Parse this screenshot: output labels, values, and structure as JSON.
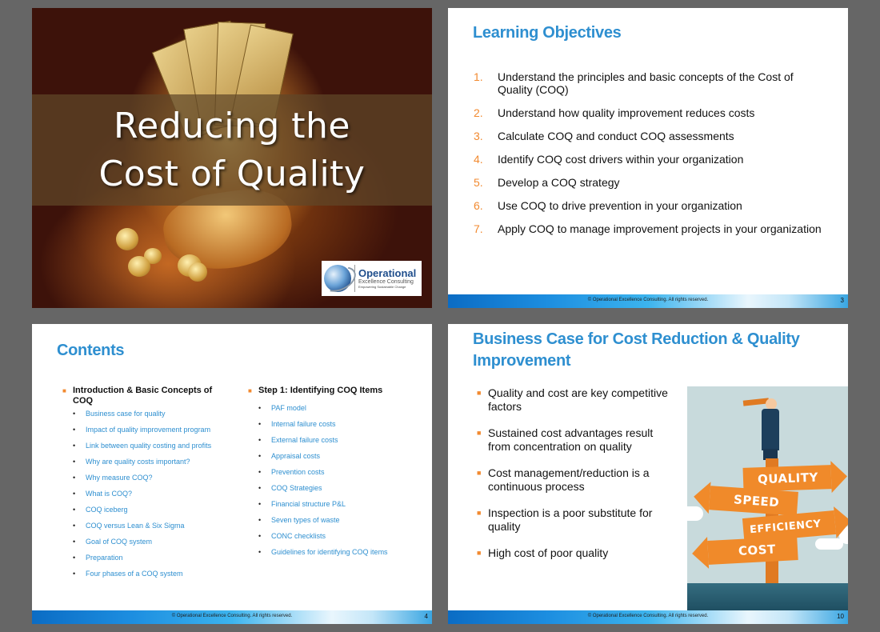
{
  "slides": [
    {
      "id": "cover",
      "title_lines": [
        "Reducing the",
        "Cost of Quality"
      ],
      "logo": {
        "name": "Operational",
        "subtitle": "Excellence Consulting",
        "tagline": "Empowering Sustainable Change"
      }
    },
    {
      "id": "learning-objectives",
      "title": "Learning Objectives",
      "items": [
        {
          "num": "1.",
          "text": "Understand the principles and basic concepts of the Cost of Quality (COQ)"
        },
        {
          "num": "2.",
          "text": "Understand how quality improvement reduces costs"
        },
        {
          "num": "3.",
          "text": "Calculate COQ and conduct COQ assessments"
        },
        {
          "num": "4.",
          "text": "Identify COQ cost drivers within your organization"
        },
        {
          "num": "5.",
          "text": "Develop a COQ strategy"
        },
        {
          "num": "6.",
          "text": "Use COQ to drive prevention in your organization"
        },
        {
          "num": "7.",
          "text": "Apply COQ to manage improvement projects in your organization"
        }
      ],
      "footer": "© Operational Excellence Consulting.  All rights reserved.",
      "page": "3"
    },
    {
      "id": "contents",
      "title": "Contents",
      "sections": [
        {
          "heading": "Introduction & Basic Concepts of COQ",
          "items": [
            "Business case for quality",
            "Impact of quality improvement program",
            "Link between quality costing and profits",
            "Why are quality costs important?",
            "Why measure COQ?",
            "What is COQ?",
            "COQ iceberg",
            "COQ versus Lean & Six Sigma",
            "Goal of COQ system",
            "Preparation",
            "Four phases of a COQ system"
          ]
        },
        {
          "heading": "Step 1: Identifying COQ Items",
          "items": [
            "PAF model",
            "Internal failure costs",
            "External failure costs",
            "Appraisal costs",
            "Prevention costs",
            "COQ Strategies",
            "Financial structure P&L",
            "Seven types of waste",
            "CONC checklists",
            "Guidelines for identifying COQ items"
          ]
        }
      ],
      "footer": "© Operational Excellence Consulting.  All rights reserved.",
      "page": "4"
    },
    {
      "id": "business-case",
      "title": "Business Case for Cost Reduction & Quality Improvement",
      "bullets": [
        "Quality and cost are key competitive factors",
        "Sustained cost advantages result from concentration on quality",
        "Cost management/reduction is a continuous process",
        "Inspection is a poor substitute for quality",
        "High cost of poor quality"
      ],
      "illustration_signs": [
        "QUALITY",
        "SPEED",
        "EFFICIENCY",
        "COST"
      ],
      "footer": "© Operational Excellence Consulting.  All rights reserved.",
      "page": "10"
    }
  ],
  "colors": {
    "title_blue": "#2e8fd0",
    "accent_orange": "#f28a30",
    "background": "#666666"
  }
}
